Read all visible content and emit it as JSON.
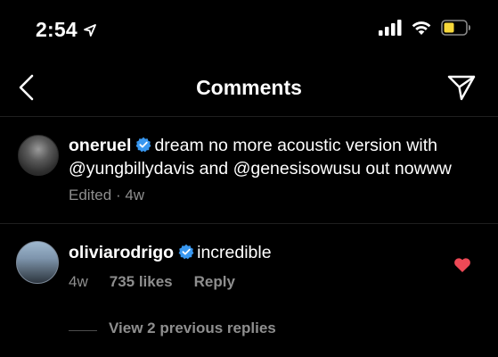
{
  "status_bar": {
    "time": "2:54",
    "icons": [
      "location-arrow-icon",
      "signal-icon",
      "wifi-icon",
      "battery-icon"
    ],
    "battery_color": "#f7d83a"
  },
  "nav": {
    "title": "Comments",
    "back_icon": "chevron-left-icon",
    "share_icon": "paper-plane-icon"
  },
  "caption": {
    "username": "oneruel",
    "verified": true,
    "text_line1": "dream no more acoustic version with",
    "text_line2": "@yungbillydavis and @genesisowusu  out nowww",
    "edited_label": "Edited",
    "separator": "·",
    "time": "4w"
  },
  "comments": [
    {
      "username": "oliviarodrigo",
      "verified": true,
      "text": "incredible",
      "time": "4w",
      "likes": "735 likes",
      "reply_label": "Reply",
      "liked": true,
      "like_color": "#ed4956"
    }
  ],
  "view_replies": "View 2 previous replies",
  "colors": {
    "background": "#000000",
    "text": "#ffffff",
    "secondary": "#8e8e8e",
    "verified": "#3897f0"
  }
}
